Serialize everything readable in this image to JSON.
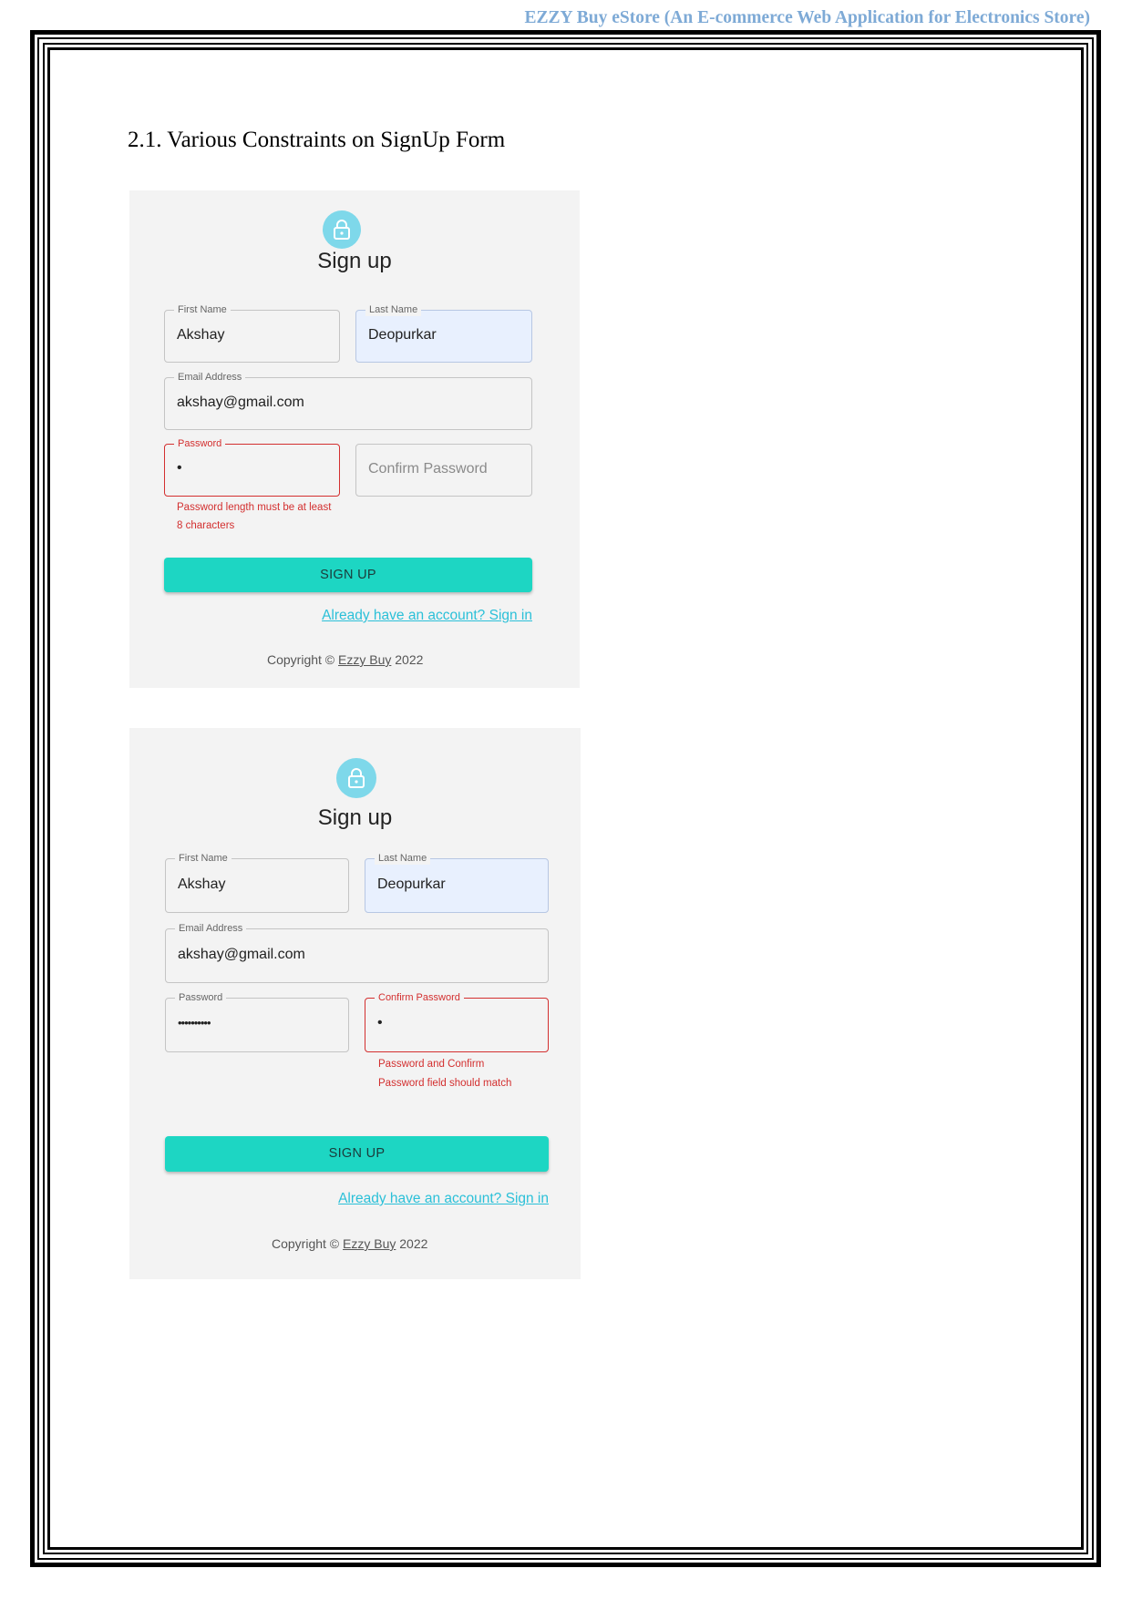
{
  "header": {
    "running_title": "EZZY Buy eStore (An E-commerce Web Application for Electronics Store)"
  },
  "section": {
    "title": "2.1. Various Constraints on SignUp Form"
  },
  "screenshots": [
    {
      "title": "Sign up",
      "first_name": {
        "label": "First Name",
        "value": "Akshay"
      },
      "last_name": {
        "label": "Last Name",
        "value": "Deopurkar"
      },
      "email": {
        "label": "Email Address",
        "value": "akshay@gmail.com"
      },
      "password": {
        "label": "Password",
        "value": "•",
        "error": "Password length must be at least 8 characters"
      },
      "confirm_password": {
        "placeholder": "Confirm Password"
      },
      "signup_button": "SIGN UP",
      "signin_link": "Already have an account? Sign in",
      "copyright": {
        "prefix": "Copyright ©",
        "brand": "Ezzy Buy",
        "year": "2022"
      }
    },
    {
      "title": "Sign up",
      "first_name": {
        "label": "First Name",
        "value": "Akshay"
      },
      "last_name": {
        "label": "Last Name",
        "value": "Deopurkar"
      },
      "email": {
        "label": "Email Address",
        "value": "akshay@gmail.com"
      },
      "password": {
        "label": "Password",
        "value": "••••••••••"
      },
      "confirm_password": {
        "label": "Confirm Password",
        "value": "•",
        "error": "Password and Confirm Password field should match"
      },
      "signup_button": "SIGN UP",
      "signin_link": "Already have an account? Sign in",
      "copyright": {
        "prefix": "Copyright ©",
        "brand": "Ezzy Buy",
        "year": "2022"
      }
    }
  ],
  "colors": {
    "accent": "#1dd6c3",
    "link": "#2bc0d8",
    "error": "#d32f2f",
    "avatar": "#7ed8ea",
    "header": "#7eaad6"
  },
  "icons": {
    "avatar": "lock-icon"
  }
}
